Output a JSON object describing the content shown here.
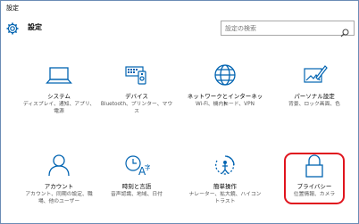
{
  "window": {
    "title": "設定"
  },
  "header": {
    "app_title": "設定",
    "search_placeholder": "設定の検索"
  },
  "tiles": [
    {
      "label": "システム",
      "desc": "ディスプレイ、通知、アプリ、電源",
      "icon": "laptop-icon"
    },
    {
      "label": "デバイス",
      "desc": "Bluetooth、プリンター、マウス",
      "icon": "devices-icon"
    },
    {
      "label": "ネットワークとインターネット",
      "desc": "Wi-Fi、機内モード、VPN",
      "icon": "globe-icon"
    },
    {
      "label": "パーソナル設定",
      "desc": "背景、ロック画面、色",
      "icon": "personalization-icon"
    },
    {
      "label": "アカウント",
      "desc": "アカウント、同期の設定、職場、他のユーザー",
      "icon": "person-icon"
    },
    {
      "label": "時刻と言語",
      "desc": "音声認識、地域、日付",
      "icon": "time-language-icon"
    },
    {
      "label": "簡単操作",
      "desc": "ナレーター、拡大鏡、ハイコントラスト",
      "icon": "ease-of-access-icon"
    },
    {
      "label": "プライバシー",
      "desc": "位置情報、カメラ",
      "icon": "lock-icon"
    }
  ],
  "colors": {
    "icon": "#0063b1",
    "highlight": "#e0141e",
    "border": "#6b8cb5"
  }
}
